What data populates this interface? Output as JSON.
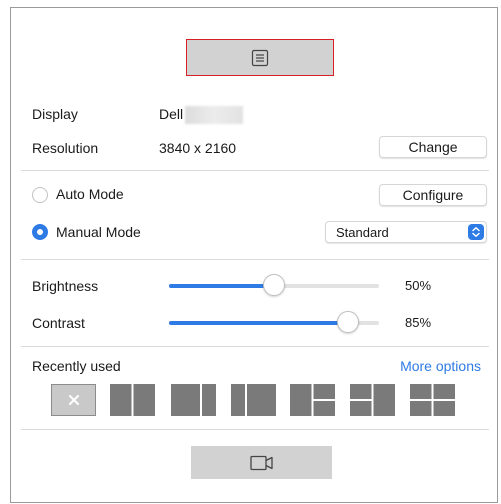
{
  "toolbar": {
    "menu_icon": "list-icon"
  },
  "display": {
    "label": "Display",
    "value": "Dell"
  },
  "resolution": {
    "label": "Resolution",
    "value": "3840 x 2160",
    "change_label": "Change"
  },
  "modes": {
    "auto_label": "Auto Mode",
    "configure_label": "Configure",
    "manual_label": "Manual Mode",
    "selected": "manual",
    "preset_selected": "Standard"
  },
  "brightness": {
    "label": "Brightness",
    "value": 50,
    "value_text": "50%"
  },
  "contrast": {
    "label": "Contrast",
    "value": 85,
    "value_text": "85%"
  },
  "recent": {
    "label": "Recently used",
    "more_label": "More options",
    "clear_icon": "close-icon",
    "layouts": [
      "clear",
      "two-columns",
      "two-columns-wide-left",
      "two-columns-wide-right",
      "left-full-right-split",
      "left-split-right-full",
      "four-quadrants"
    ]
  },
  "bottom": {
    "icon": "video-camera-icon"
  },
  "colors": {
    "accent": "#2f7be6",
    "highlight_border": "#d81f26",
    "tile_fill": "#7a7a7a",
    "button_gray": "#d2d2d2"
  }
}
